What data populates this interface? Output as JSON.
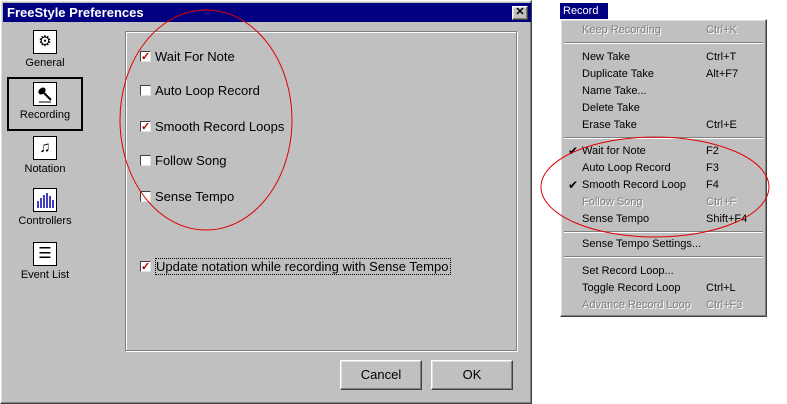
{
  "dialog": {
    "title": "FreeStyle Preferences",
    "close_glyph": "✕",
    "sidebar": [
      {
        "label": "General",
        "icon": "gear-icon",
        "glyph": "⚙"
      },
      {
        "label": "Recording",
        "icon": "microphone-icon",
        "glyph": "🎤",
        "selected": true
      },
      {
        "label": "Notation",
        "icon": "music-note-icon",
        "glyph": "♫"
      },
      {
        "label": "Controllers",
        "icon": "controllers-icon",
        "glyph": "▟"
      },
      {
        "label": "Event List",
        "icon": "list-icon",
        "glyph": "☰"
      }
    ],
    "options": {
      "wait_for_note": {
        "label": "Wait For Note",
        "checked": true
      },
      "auto_loop_record": {
        "label": "Auto Loop Record",
        "checked": false
      },
      "smooth_record_loops": {
        "label": "Smooth Record Loops",
        "checked": true
      },
      "follow_song": {
        "label": "Follow Song",
        "checked": false
      },
      "sense_tempo": {
        "label": "Sense Tempo",
        "checked": false
      },
      "update_notation": {
        "label": "Update notation while recording with Sense Tempo",
        "checked": true
      }
    },
    "buttons": {
      "cancel": "Cancel",
      "ok": "OK"
    }
  },
  "menu": {
    "title": "Record",
    "items": [
      {
        "label": "Keep Recording",
        "shortcut": "Ctrl+K",
        "disabled": true
      },
      {
        "label": "New Take",
        "shortcut": "Ctrl+T"
      },
      {
        "label": "Duplicate Take",
        "shortcut": "Alt+F7"
      },
      {
        "label": "Name Take...",
        "shortcut": ""
      },
      {
        "label": "Delete Take",
        "shortcut": ""
      },
      {
        "label": "Erase Take",
        "shortcut": "Ctrl+E"
      },
      {
        "label": "Wait for Note",
        "shortcut": "F2",
        "checked": true
      },
      {
        "label": "Auto Loop Record",
        "shortcut": "F3"
      },
      {
        "label": "Smooth Record Loop",
        "shortcut": "F4",
        "checked": true
      },
      {
        "label": "Follow Song",
        "shortcut": "Ctrl+F",
        "disabled": true
      },
      {
        "label": "Sense Tempo",
        "shortcut": "Shift+F4"
      },
      {
        "label": "Sense Tempo Settings...",
        "shortcut": ""
      },
      {
        "label": "Set Record Loop...",
        "shortcut": ""
      },
      {
        "label": "Toggle Record Loop",
        "shortcut": "Ctrl+L"
      },
      {
        "label": "Advance Record Loop",
        "shortcut": "Ctrl+F3",
        "disabled": true
      }
    ],
    "check_glyph": "✔"
  }
}
